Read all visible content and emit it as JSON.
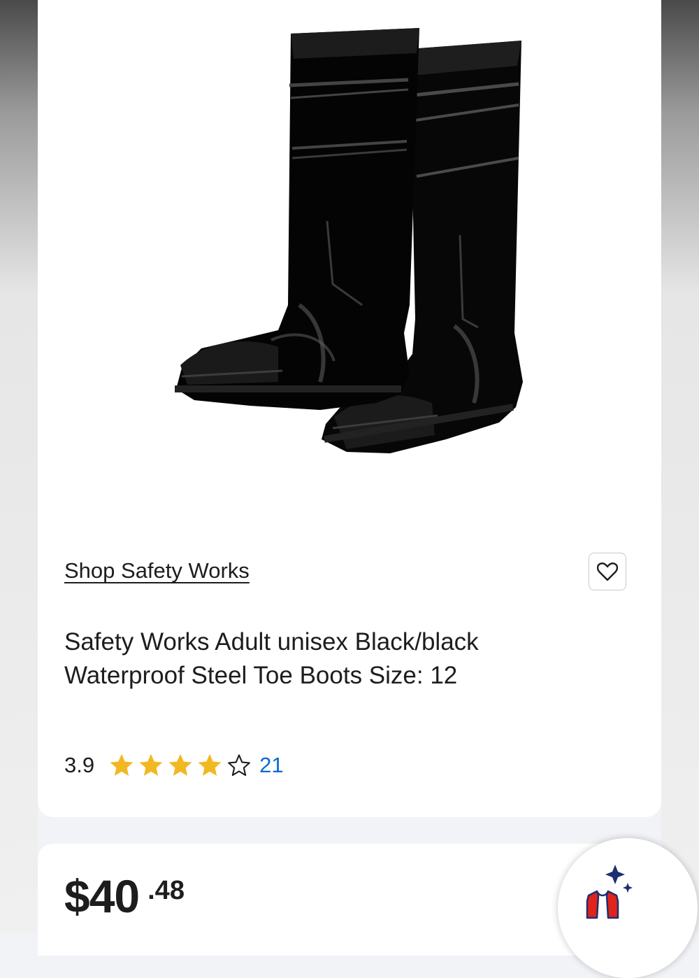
{
  "product": {
    "image_alt": "Black knee-high rubber steel toe boots",
    "shop_link": "Shop Safety Works",
    "favorite_icon": "heart-outline-icon",
    "title_line1": "Safety Works Adult unisex Black/black",
    "title_line2": "Waterproof Steel Toe Boots Size: 12",
    "rating": "3.9",
    "rating_value": 3.9,
    "rating_max": 5,
    "review_count": "21"
  },
  "price": {
    "whole": "$40",
    "cents": ".48"
  },
  "assistant": {
    "icon": "sparkle-vest-icon"
  },
  "colors": {
    "star": "#f2b821",
    "link": "#0b6ad6",
    "assistant_navy": "#1d2f6f",
    "assistant_red": "#e2231a"
  }
}
